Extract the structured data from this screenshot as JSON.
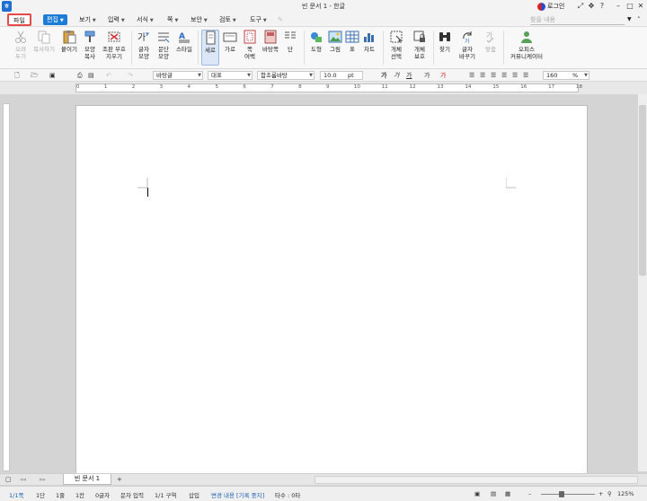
{
  "window": {
    "title": "빈 문서 1 - 한글",
    "login": "로그인",
    "app_icon_letter": "ㅎ"
  },
  "menu": {
    "file": "파일",
    "edit": "편집",
    "view": "보기",
    "insert": "입력",
    "format": "서식",
    "page": "쪽",
    "security": "보안",
    "review": "검토",
    "tools": "도구"
  },
  "search": {
    "placeholder": "찾을 내용"
  },
  "ribbon": {
    "cut": "오려\n두기",
    "copy": "복사하기",
    "paste": "붙이기",
    "format_copy": "모양\n복사",
    "clear_format": "조판 부호\n지우기",
    "char_shape": "글자\n모양",
    "para_shape": "문단\n모양",
    "style": "스타일",
    "vertical": "세로",
    "horizontal": "가로",
    "page_margin": "쪽\n여백",
    "background": "바탕쪽",
    "columns": "단",
    "shape": "도형",
    "picture": "그림",
    "table": "표",
    "chart": "차트",
    "object_select": "개체\n선택",
    "object_protect": "개체\n보호",
    "find": "찾기",
    "char_replace": "글자\n바꾸기",
    "spell": "맞춤",
    "office": "오피스\n커뮤니케이터"
  },
  "format_bar": {
    "style_name": "바탕글",
    "style_type": "대표",
    "font": "함초롬바탕",
    "font_size": "10.0",
    "size_unit": "pt",
    "zoom_value": "160",
    "zoom_unit": "%"
  },
  "ruler": {
    "ticks": [
      "0",
      "1",
      "2",
      "3",
      "4",
      "5",
      "6",
      "7",
      "8",
      "9",
      "10",
      "11",
      "12",
      "13",
      "14",
      "15",
      "16",
      "17",
      "18"
    ]
  },
  "tabs": {
    "doc_tab": "빈 문서 1",
    "add_tab": "+"
  },
  "status": {
    "page": "1/1쪽",
    "section_col": "1단",
    "line": "1줄",
    "col": "1칸",
    "chars": "0글자",
    "input_mode": "문자 입력",
    "section": "1/1 구역",
    "insert_mode": "삽입",
    "track_changes": "변경 내용 [기록 중지]",
    "typing_speed": "타수 : 0타",
    "zoom": "125%"
  },
  "colors": {
    "accent": "#1c7cd6",
    "highlight_border": "#e84a4a"
  }
}
